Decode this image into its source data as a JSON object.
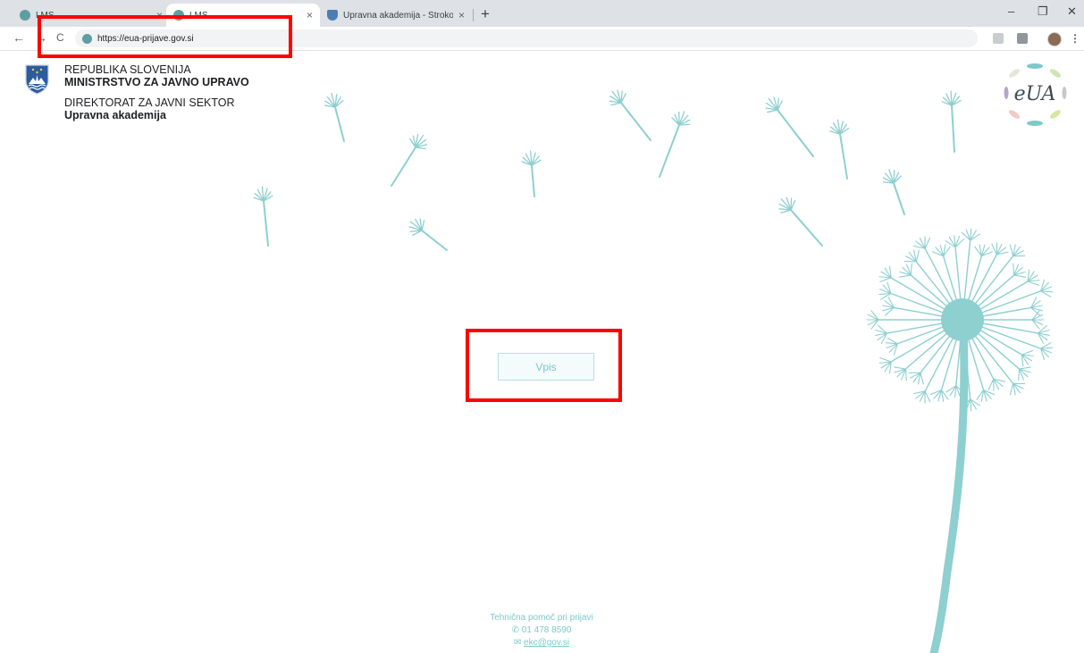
{
  "browser": {
    "tabs": [
      {
        "label": "LMS",
        "active": false
      },
      {
        "label": "LMS",
        "active": true
      },
      {
        "label": "Upravna akademija - Strokovni u",
        "active": false
      }
    ],
    "close_glyph": "×",
    "new_tab_glyph": "+",
    "window_controls": {
      "minimize": "–",
      "restore": "❐",
      "close": "✕"
    },
    "nav": {
      "back": "←",
      "forward": "→",
      "reload": "C"
    },
    "address_bar": {
      "url": "https://eua-prijave.gov.si"
    },
    "menu_glyph": "⋮"
  },
  "header": {
    "line1": "REPUBLIKA SLOVENIJA",
    "line2": "MINISTRSTVO ZA JAVNO UPRAVO",
    "line3": "DIREKTORAT ZA JAVNI SEKTOR",
    "line4": "Upravna akademija"
  },
  "logo": {
    "text": "eUA"
  },
  "main": {
    "login_button": "Vpis"
  },
  "footer": {
    "title": "Tehnična pomoč pri prijavi",
    "phone_icon": "✆",
    "phone": "01 478 8590",
    "email_icon": "✉",
    "email": "ekc@gov.si"
  },
  "colors": {
    "accent": "#7cc9c9",
    "dandelion": "#8ecfd0",
    "highlight": "#ff0000"
  }
}
